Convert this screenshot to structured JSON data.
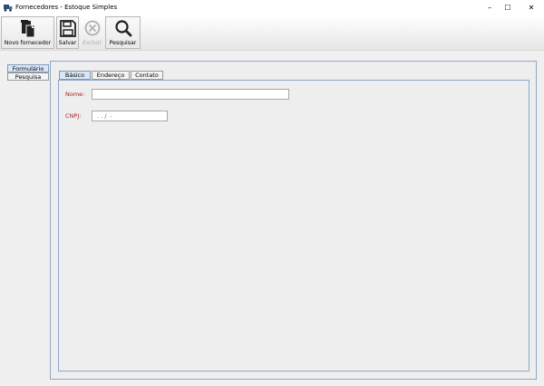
{
  "window": {
    "title": "Fornecedores - Estoque Simples",
    "controls": {
      "minimize": "–",
      "maximize": "☐",
      "close": "✕"
    }
  },
  "toolbar": {
    "buttons": [
      {
        "label": "Novo fornecedor",
        "icon": "new-document-icon",
        "enabled": true
      },
      {
        "label": "Salvar",
        "icon": "save-floppy-icon",
        "enabled": true
      },
      {
        "label": "Excluir",
        "icon": "delete-x-circle-icon",
        "enabled": false
      },
      {
        "label": "Pesquisar",
        "icon": "search-magnifier-icon",
        "enabled": true
      }
    ]
  },
  "side_tabs": [
    {
      "label": "Formulário",
      "active": true
    },
    {
      "label": "Pesquisa",
      "active": false
    }
  ],
  "form_tabs": [
    {
      "label": "Básico",
      "active": true
    },
    {
      "label": "Endereço",
      "active": false
    },
    {
      "label": "Contato",
      "active": false
    }
  ],
  "form": {
    "nome": {
      "label": "Nome:",
      "value": ""
    },
    "cnpj": {
      "label": "CNPJ:",
      "value": " . . /  -"
    }
  },
  "colors": {
    "required_label": "#b02020",
    "active_tab": "#dbe6f4",
    "panel_border": "#8fa8c8"
  }
}
